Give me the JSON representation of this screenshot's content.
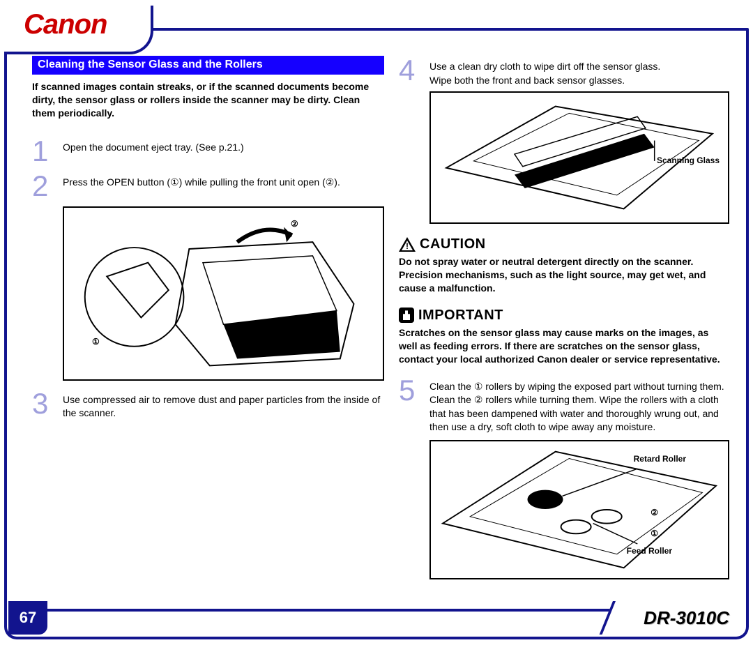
{
  "brand": "Canon",
  "page_number": "67",
  "model": "DR-3010C",
  "section_title": "Cleaning the Sensor Glass and the Rollers",
  "intro": "If scanned images contain streaks, or if the scanned documents become dirty, the sensor glass or rollers inside the scanner may be dirty. Clean them periodically.",
  "steps": {
    "s1": {
      "num": "1",
      "text": "Open the document eject tray. (See p.21.)"
    },
    "s2": {
      "num": "2",
      "text": "Press the OPEN button (①) while pulling the front unit open (②)."
    },
    "s3": {
      "num": "3",
      "text": "Use compressed air to remove dust and paper particles from the inside of the scanner."
    },
    "s4": {
      "num": "4",
      "text_line1": "Use a clean dry cloth to wipe dirt off the sensor glass.",
      "text_line2": "Wipe both the front and back sensor glasses."
    },
    "s5": {
      "num": "5",
      "text": "Clean the ① rollers by wiping the exposed part without turning them. Clean the ② rollers while turning them. Wipe the rollers with a cloth that has been dampened with water and thoroughly wrung out, and then use a dry, soft cloth to wipe away any moisture."
    }
  },
  "callouts": {
    "fig2": {
      "c1": "①",
      "c2": "②"
    },
    "fig4": {
      "label": "Scanning Glass"
    },
    "fig5": {
      "label1": "Retard Roller",
      "label2": "Feed Roller",
      "m1": "①",
      "m2": "②"
    }
  },
  "caution": {
    "title": "CAUTION",
    "body": "Do not spray water or neutral detergent directly on the scanner. Precision mechanisms, such as the light source, may get wet, and cause a malfunction."
  },
  "important": {
    "title": "IMPORTANT",
    "body": "Scratches on the sensor glass may cause marks on the images, as well as feeding errors. If there are scratches on the sensor glass, contact your local authorized Canon dealer or service representative."
  }
}
